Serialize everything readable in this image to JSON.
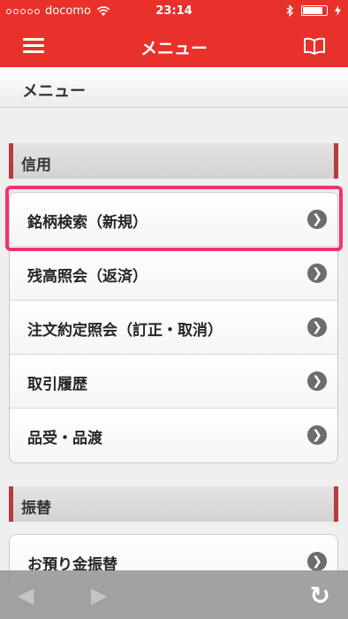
{
  "status_bar": {
    "carrier": "docomo",
    "time": "23:14",
    "battery_level": 0.85
  },
  "nav_bar": {
    "title": "メニュー"
  },
  "page_header": {
    "title": "メニュー"
  },
  "sections": [
    {
      "title": "信用",
      "items": [
        {
          "label": "銘柄検索（新規）"
        },
        {
          "label": "残高照会（返済）"
        },
        {
          "label": "注文約定照会（訂正・取消）"
        },
        {
          "label": "取引履歴"
        },
        {
          "label": "品受・品渡"
        }
      ]
    },
    {
      "title": "振替",
      "items": [
        {
          "label": "お預り金振替"
        }
      ]
    }
  ],
  "icons": {
    "menu": "hamburger-menu-icon",
    "book": "book-icon",
    "chevron": "chevron-right-circle-icon",
    "back": "back-arrow-icon",
    "forward": "forward-arrow-icon",
    "reload": "reload-icon"
  },
  "colors": {
    "brand_red": "#e8312b",
    "highlight": "#f0336e",
    "section_accent": "#b93a3a"
  }
}
